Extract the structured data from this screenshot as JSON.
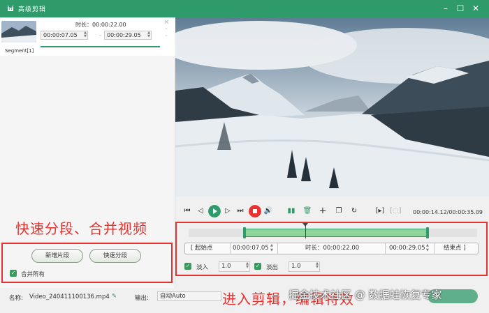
{
  "window": {
    "title": "高级剪辑"
  },
  "segment": {
    "label": "Segment[1]",
    "duration": "时长：00:00:22.00",
    "start": "00:00:07.05",
    "end": "00:00:29.05",
    "separator": "-"
  },
  "annotations": {
    "left": "快速分段、合并视频",
    "bottom": "进入剪辑，编辑特效"
  },
  "left_buttons": {
    "new_segment": "新增片段",
    "quick_split": "快速分段"
  },
  "merge_all": {
    "label": "合并所有",
    "checked": true
  },
  "player": {
    "time": "00:00:14.12/00:00:35.09"
  },
  "trim": {
    "start_btn": "[ 起始点",
    "start_time": "00:00:07.05",
    "duration": "时长：00:00:22.00",
    "end_time": "00:00:29.05",
    "end_btn": "结束点 ]"
  },
  "fade": {
    "in_label": "淡入",
    "in_value": "1.0",
    "out_label": "淡出",
    "out_value": "1.0"
  },
  "bottom": {
    "name_label": "名称:",
    "file_name": "Video_240411100136.mp4",
    "output_label": "输出:",
    "output_value": "自动Auto"
  },
  "watermark": "掘金技术社区 @ 数据蛙恢复专家",
  "colors": {
    "brand": "#2f9a6a",
    "annotation": "#e8322f"
  }
}
